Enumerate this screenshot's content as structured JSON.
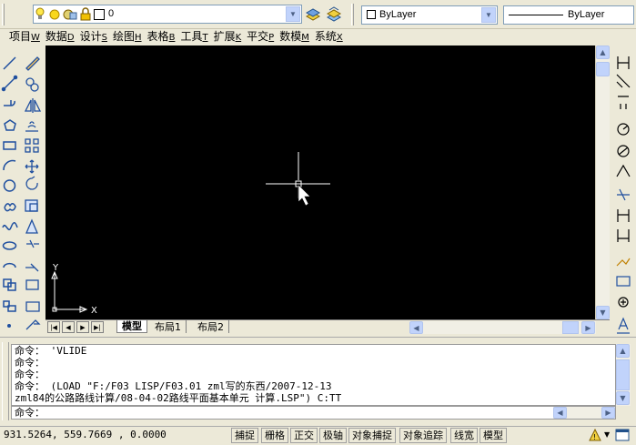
{
  "layer_toolbar": {
    "layer_name": "0",
    "color_value": "ByLayer",
    "linetype_value": "ByLayer"
  },
  "menu": [
    {
      "label": "项目",
      "key": "W"
    },
    {
      "label": "数据",
      "key": "D"
    },
    {
      "label": "设计",
      "key": "S"
    },
    {
      "label": "绘图",
      "key": "H"
    },
    {
      "label": "表格",
      "key": "B"
    },
    {
      "label": "工具",
      "key": "T"
    },
    {
      "label": "扩展",
      "key": "K"
    },
    {
      "label": "平交",
      "key": "P"
    },
    {
      "label": "数模",
      "key": "M"
    },
    {
      "label": "系统",
      "key": "X"
    }
  ],
  "ucs": {
    "x_label": "X",
    "y_label": "Y"
  },
  "tabs": {
    "model": "模型",
    "layout1": "布局1",
    "layout2": "布局2"
  },
  "command_history": [
    "命令： 'VLIDE",
    "命令：",
    "命令：",
    "命令： (LOAD \"F:/F03 LISP/F03.01 zml写的东西/2007-12-13",
    "zml84的公路路线计算/08-04-02路线平面基本单元 计算.LSP\") C:TT"
  ],
  "command_prompt": "命令：",
  "status": {
    "coordinates": "931.5264,  559.7669 , 0.0000",
    "toggles": [
      "捕捉",
      "栅格",
      "正交",
      "极轴",
      "对象捕捉",
      "对象追踪",
      "线宽",
      "模型"
    ]
  },
  "colors": {
    "canvas": "#000000",
    "chrome": "#ece9d8",
    "accent": "#c1d3fb"
  }
}
